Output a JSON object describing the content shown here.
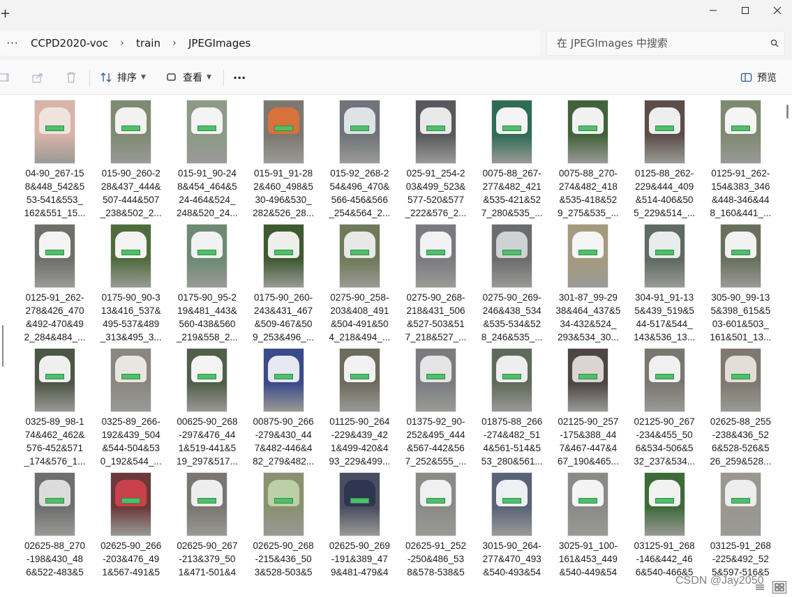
{
  "window": {
    "new_tab_symbol": "+",
    "controls": {
      "minimize": "—",
      "maximize": "☐",
      "close": "✕"
    }
  },
  "address_bar": {
    "more_symbol": "···",
    "breadcrumbs": [
      "CCPD2020-voc",
      "train",
      "JPEGImages"
    ],
    "separator": "›"
  },
  "search": {
    "placeholder": "在 JPEGImages 中搜索"
  },
  "command_bar": {
    "sort_label": "排序",
    "view_label": "查看",
    "more_label": "···",
    "preview_label": "预览"
  },
  "files": [
    {
      "lines": [
        "04-90_267-15",
        "8&448_542&5",
        "53-541&553_",
        "162&551_15..."
      ],
      "body": "#efe3de",
      "ground": "#d8b3a8"
    },
    {
      "lines": [
        "015-90_260-2",
        "28&437_444&",
        "507-444&507",
        "_238&502_2..."
      ],
      "body": "#f2f2f0",
      "ground": "#7f8a72"
    },
    {
      "lines": [
        "015-91_90-24",
        "8&454_464&5",
        "24-464&524_",
        "248&520_24..."
      ],
      "body": "#f4f4f4",
      "ground": "#8c9a86"
    },
    {
      "lines": [
        "015-91_91-28",
        "2&460_498&5",
        "30-496&530_",
        "282&526_28..."
      ],
      "body": "#d9713a",
      "ground": "#7c7770"
    },
    {
      "lines": [
        "015-92_268-2",
        "54&496_470&",
        "566-456&566",
        "_254&564_2..."
      ],
      "body": "#dfe3e8",
      "ground": "#6f747a"
    },
    {
      "lines": [
        "025-91_254-2",
        "03&499_523&",
        "577-520&577",
        "_222&576_2..."
      ],
      "body": "#e9e9e9",
      "ground": "#58595c"
    },
    {
      "lines": [
        "0075-88_267-",
        "277&482_421",
        "&535-421&52",
        "7_280&535_..."
      ],
      "body": "#f4f4f4",
      "ground": "#2e6d54"
    },
    {
      "lines": [
        "0075-88_270-",
        "274&482_418",
        "&535-418&52",
        "9_275&535_..."
      ],
      "body": "#f1f1f1",
      "ground": "#42623a"
    },
    {
      "lines": [
        "0125-88_262-",
        "229&444_409",
        "&514-406&50",
        "5_229&514_..."
      ],
      "body": "#eeeeee",
      "ground": "#5b4d48"
    },
    {
      "lines": [
        "0125-91_262-",
        "154&383_346",
        "&448-346&44",
        "8_160&441_..."
      ],
      "body": "#f5f5f5",
      "ground": "#7d8a70"
    },
    {
      "lines": [
        "0125-91_262-",
        "278&426_470",
        "&492-470&49",
        "2_284&484_..."
      ],
      "body": "#f4f4f4",
      "ground": "#6e6e6a"
    },
    {
      "lines": [
        "0175-90_90-3",
        "13&416_537&",
        "495-537&489",
        "_313&495_3..."
      ],
      "body": "#f3f3f3",
      "ground": "#4f6c3d"
    },
    {
      "lines": [
        "0175-90_95-2",
        "19&481_443&",
        "560-438&560",
        "_219&558_2..."
      ],
      "body": "#f2f2f2",
      "ground": "#6d8a72"
    },
    {
      "lines": [
        "0175-90_260-",
        "243&431_467",
        "&509-467&50",
        "9_253&496_..."
      ],
      "body": "#eeeeea",
      "ground": "#3e5a31"
    },
    {
      "lines": [
        "0275-90_258-",
        "203&408_491",
        "&504-491&50",
        "4_218&494_..."
      ],
      "body": "#e8e8e6",
      "ground": "#6f7a58"
    },
    {
      "lines": [
        "0275-90_268-",
        "218&431_506",
        "&527-503&51",
        "7_218&527_..."
      ],
      "body": "#f2f2f4",
      "ground": "#7a7a80"
    },
    {
      "lines": [
        "0275-90_269-",
        "246&438_534",
        "&535-534&52",
        "8_246&535_..."
      ],
      "body": "#cfd2d4",
      "ground": "#6b6c6e"
    },
    {
      "lines": [
        "301-87_99-29",
        "38&464_437&5",
        "34-432&524_",
        "293&534_30..."
      ],
      "body": "#f5f5f5",
      "ground": "#a59a7e"
    },
    {
      "lines": [
        "304-91_91-13",
        "5&439_519&5",
        "44-517&544_",
        "143&536_13..."
      ],
      "body": "#e8ecec",
      "ground": "#5f6a62"
    },
    {
      "lines": [
        "305-90_99-13",
        "5&398_615&5",
        "03-601&503_",
        "161&501_13..."
      ],
      "body": "#f2f2f2",
      "ground": "#68705c"
    },
    {
      "lines": [
        "0325-89_98-1",
        "74&462_462&",
        "576-452&571",
        "_174&576_1..."
      ],
      "body": "#efefef",
      "ground": "#4c5646"
    },
    {
      "lines": [
        "0325-89_266-",
        "192&439_504",
        "&544-504&53",
        "0_192&544_..."
      ],
      "body": "#e8e6e0",
      "ground": "#8a8680"
    },
    {
      "lines": [
        "00625-90_268",
        "-297&476_44",
        "1&519-441&5",
        "19_297&517..."
      ],
      "body": "#f3f3f3",
      "ground": "#4f5f4a"
    },
    {
      "lines": [
        "00875-90_266",
        "-279&430_44",
        "7&482-446&4",
        "82_279&482..."
      ],
      "body": "#e6e8f2",
      "ground": "#3b4a8a"
    },
    {
      "lines": [
        "01125-90_264",
        "-229&439_42",
        "1&499-420&4",
        "93_229&499..."
      ],
      "body": "#f2f2f2",
      "ground": "#6e6a5e"
    },
    {
      "lines": [
        "01375-92_90-",
        "252&495_444",
        "&567-442&56",
        "7_252&555_..."
      ],
      "body": "#e4e4e4",
      "ground": "#7a7c80"
    },
    {
      "lines": [
        "01875-88_266",
        "-274&482_51",
        "4&561-514&5",
        "53_280&561..."
      ],
      "body": "#eeeeee",
      "ground": "#606a5a"
    },
    {
      "lines": [
        "02125-90_257",
        "-175&388_44",
        "7&467-447&4",
        "67_190&465..."
      ],
      "body": "#dcd4d2",
      "ground": "#4e4644"
    },
    {
      "lines": [
        "02125-90_267",
        "-234&455_50",
        "6&534-506&5",
        "32_237&534..."
      ],
      "body": "#f0f0f0",
      "ground": "#7a7670"
    },
    {
      "lines": [
        "02625-88_255",
        "-238&436_52",
        "6&528-526&5",
        "26_259&528..."
      ],
      "body": "#e2ddd6",
      "ground": "#807870"
    },
    {
      "lines": [
        "02625-88_270",
        "-198&430_48",
        "6&522-483&5",
        ""
      ],
      "body": "#dcdcdc",
      "ground": "#6e6e6e"
    },
    {
      "lines": [
        "02625-90_266",
        "-203&476_49",
        "1&567-491&5",
        ""
      ],
      "body": "#c9414b",
      "ground": "#6a3a3a"
    },
    {
      "lines": [
        "02625-90_267",
        "-213&379_50",
        "1&471-501&4",
        ""
      ],
      "body": "#eeeeee",
      "ground": "#7a7672"
    },
    {
      "lines": [
        "02625-90_268",
        "-215&436_50",
        "3&528-503&5",
        ""
      ],
      "body": "#bcd0a8",
      "ground": "#8a9070"
    },
    {
      "lines": [
        "02625-90_269",
        "-191&389_47",
        "9&481-479&4",
        ""
      ],
      "body": "#2f3550",
      "ground": "#4a4e60"
    },
    {
      "lines": [
        "02625-91_252",
        "-250&486_53",
        "8&578-538&5",
        ""
      ],
      "body": "#f0f0f0",
      "ground": "#8a8a86"
    },
    {
      "lines": [
        "3015-90_264-",
        "277&470_493",
        "&540-493&54",
        ""
      ],
      "body": "#eef0f4",
      "ground": "#5a6478"
    },
    {
      "lines": [
        "3025-91_100-",
        "161&453_449",
        "&540-449&54",
        ""
      ],
      "body": "#f4f4f4",
      "ground": "#8a8a86"
    },
    {
      "lines": [
        "03125-91_268",
        "-146&442_46",
        "6&540-466&5",
        ""
      ],
      "body": "#f2f2f2",
      "ground": "#3e6a3a"
    },
    {
      "lines": [
        "03125-91_268",
        "-225&492_52",
        "5&597-516&5",
        ""
      ],
      "body": "#ededed",
      "ground": "#9a9690"
    }
  ],
  "watermark": "CSDN @Jay2050"
}
